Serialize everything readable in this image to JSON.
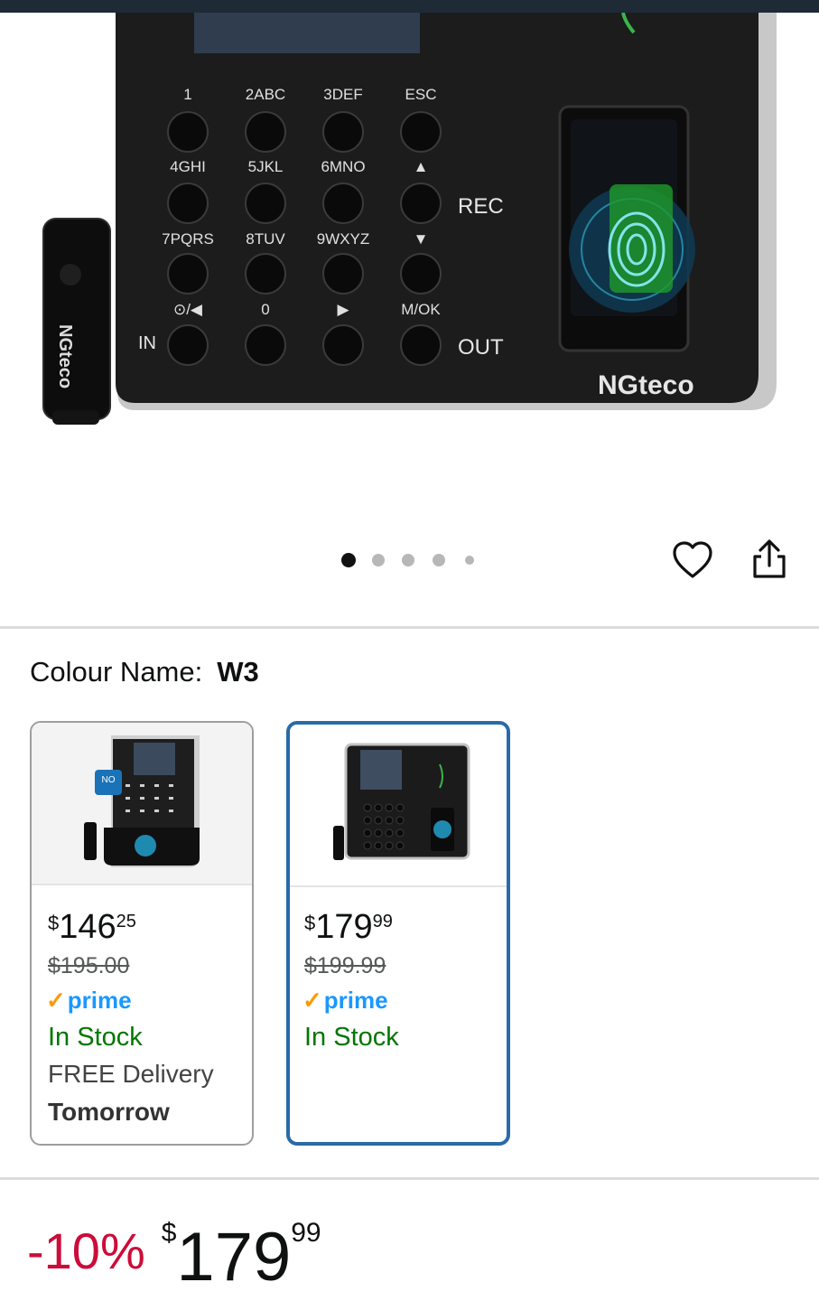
{
  "product_images": {
    "keypad_keys": [
      {
        "top": "1",
        "bottom": ""
      },
      {
        "top": "2ABC",
        "bottom": ""
      },
      {
        "top": "3DEF",
        "bottom": ""
      },
      {
        "top": "ESC",
        "bottom": ""
      }
    ],
    "keypad_labels_row1": [
      "1",
      "2ABC",
      "3DEF",
      "ESC"
    ],
    "keypad_labels_row2": [
      "4GHI",
      "5JKL",
      "6MNO",
      "▲"
    ],
    "keypad_labels_row3": [
      "7PQRS",
      "8TUV",
      "9WXYZ",
      "▼"
    ],
    "keypad_labels_row4": [
      "⊙/◀",
      "0",
      "▶",
      "M/OK"
    ],
    "rec_label": "REC",
    "out_label": "OUT",
    "in_label": "IN",
    "brand_logo": "NGteco"
  },
  "carousel": {
    "total": 5,
    "active_index": 0
  },
  "actions": {
    "wishlist_icon": "heart-icon",
    "share_icon": "share-icon"
  },
  "colour": {
    "label": "Colour Name:",
    "value": "W3"
  },
  "variants": [
    {
      "price_symbol": "$",
      "price_whole": "146",
      "price_fraction": "25",
      "list_price": "$195.00",
      "prime_label": "prime",
      "stock": "In Stock",
      "delivery": "FREE Delivery",
      "delivery_day": "Tomorrow",
      "selected": false,
      "thumb_badge": "NO"
    },
    {
      "price_symbol": "$",
      "price_whole": "179",
      "price_fraction": "99",
      "list_price": "$199.99",
      "prime_label": "prime",
      "stock": "In Stock",
      "selected": true
    }
  ],
  "price": {
    "discount": "-10%",
    "symbol": "$",
    "whole": "179",
    "fraction": "99"
  },
  "colors": {
    "prime_blue": "#1a98ff",
    "prime_check": "#ff9900",
    "in_stock": "#007600",
    "discount_red": "#cc0c39",
    "selected_border": "#2a6aa8"
  }
}
